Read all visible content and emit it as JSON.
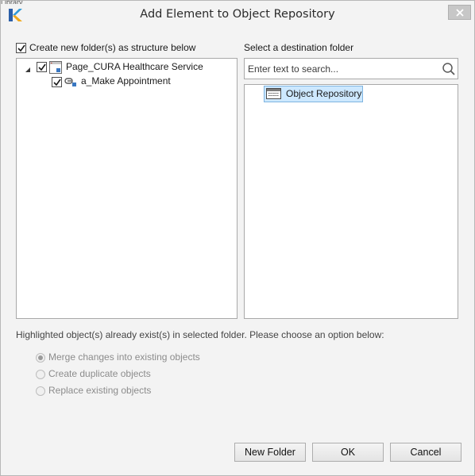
{
  "titlebar": {
    "partial_text": "Library",
    "title": "Add Element to Object Repository",
    "close_label": "×"
  },
  "left_panel": {
    "create_folder_checkbox": {
      "label": "Create new folder(s) as structure below",
      "checked": true
    },
    "tree": [
      {
        "label": "Page_CURA Healthcare Service",
        "checked": true,
        "expanded": true,
        "icon": "web-page-icon"
      },
      {
        "label": "a_Make Appointment",
        "checked": true,
        "icon": "link-element-icon"
      }
    ]
  },
  "right_panel": {
    "label": "Select a destination folder",
    "search": {
      "value": "",
      "placeholder": "Enter text to search..."
    },
    "folders": [
      {
        "label": "Object Repository",
        "selected": true,
        "icon": "repository-folder-icon"
      }
    ]
  },
  "options": {
    "info": "Highlighted object(s) already exist(s) in selected folder. Please choose an option below:",
    "radios": [
      {
        "label": "Merge changes into existing objects",
        "selected": true,
        "enabled": false
      },
      {
        "label": "Create duplicate objects",
        "selected": false,
        "enabled": false
      },
      {
        "label": "Replace existing objects",
        "selected": false,
        "enabled": false
      }
    ]
  },
  "buttons": {
    "new_folder": "New Folder",
    "ok": "OK",
    "cancel": "Cancel"
  },
  "colors": {
    "accent": "#0078d7",
    "selection_bg": "#cde8ff",
    "dialog_bg": "#f3f3f3",
    "disabled_text": "#8c8c8c"
  }
}
